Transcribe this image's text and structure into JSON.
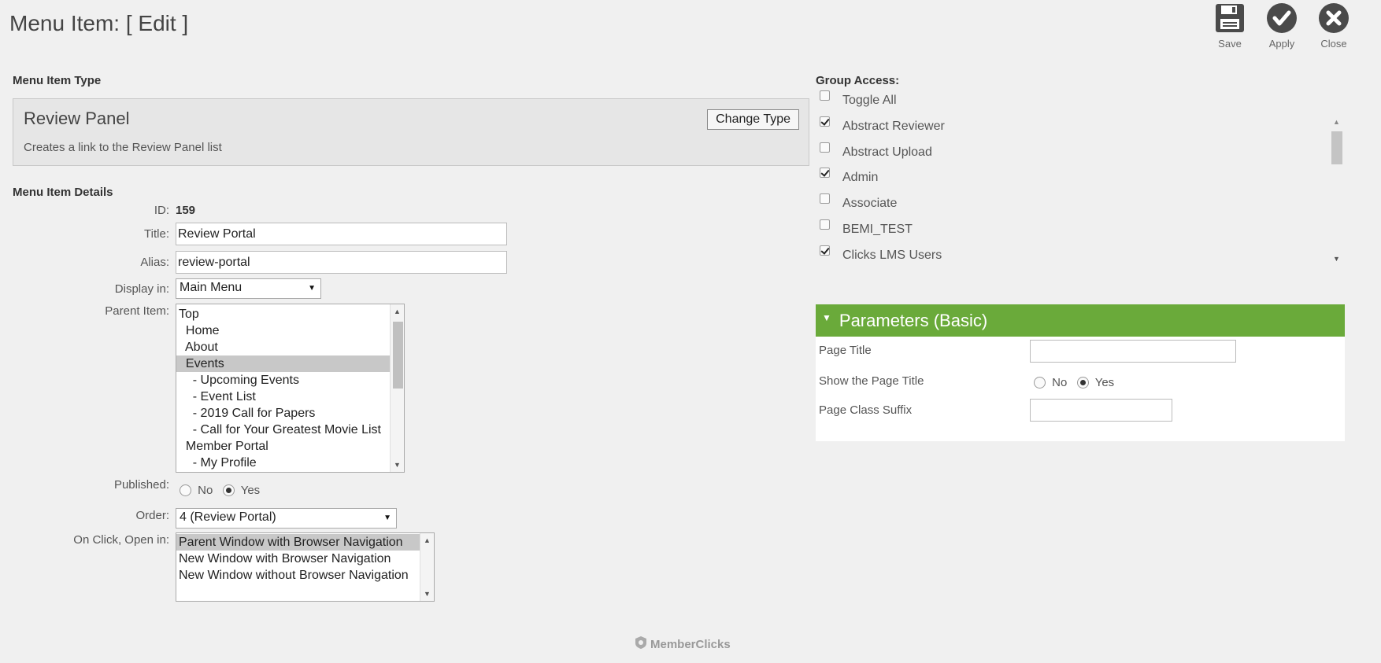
{
  "page": {
    "title": "Menu Item: [ Edit ]"
  },
  "toolbar": {
    "save": "Save",
    "apply": "Apply",
    "close": "Close"
  },
  "menu_item_type": {
    "section_label": "Menu Item Type",
    "name": "Review Panel",
    "description": "Creates a link to the Review Panel list",
    "change_button": "Change Type"
  },
  "details": {
    "section_label": "Menu Item Details",
    "id_label": "ID:",
    "id_value": "159",
    "title_label": "Title:",
    "title_value": "Review Portal",
    "alias_label": "Alias:",
    "alias_value": "review-portal",
    "display_label": "Display in:",
    "display_value": "Main Menu",
    "parent_label": "Parent Item:",
    "parent_items": [
      "Top",
      "  Home",
      "  About",
      "  Events",
      "    - Upcoming Events",
      "    - Event List",
      "    - 2019 Call for Papers",
      "    - Call for Your Greatest Movie List",
      "  Member Portal",
      "    - My Profile"
    ],
    "parent_selected_index": 3,
    "published_label": "Published:",
    "published_no": "No",
    "published_yes": "Yes",
    "published_value": "Yes",
    "order_label": "Order:",
    "order_value": "4 (Review Portal)",
    "onclick_label": "On Click, Open in:",
    "onclick_options": [
      "Parent Window with Browser Navigation",
      "New Window with Browser Navigation",
      "New Window without Browser Navigation"
    ],
    "onclick_selected_index": 0
  },
  "group_access": {
    "section_label": "Group Access:",
    "items": [
      {
        "label": "Toggle All",
        "checked": false
      },
      {
        "label": "Abstract Reviewer",
        "checked": true
      },
      {
        "label": "Abstract Upload",
        "checked": false
      },
      {
        "label": "Admin",
        "checked": true
      },
      {
        "label": "Associate",
        "checked": false
      },
      {
        "label": "BEMI_TEST",
        "checked": false
      },
      {
        "label": "Clicks LMS Users",
        "checked": true
      }
    ]
  },
  "parameters": {
    "header": "Parameters (Basic)",
    "page_title_label": "Page Title",
    "page_title_value": "",
    "show_title_label": "Show the Page Title",
    "show_no": "No",
    "show_yes": "Yes",
    "show_value": "Yes",
    "class_suffix_label": "Page Class Suffix",
    "class_suffix_value": ""
  },
  "footer": {
    "brand": "MemberClicks"
  },
  "colors": {
    "accent_green": "#6aaa3a",
    "icon_dark": "#4a4a4a"
  }
}
